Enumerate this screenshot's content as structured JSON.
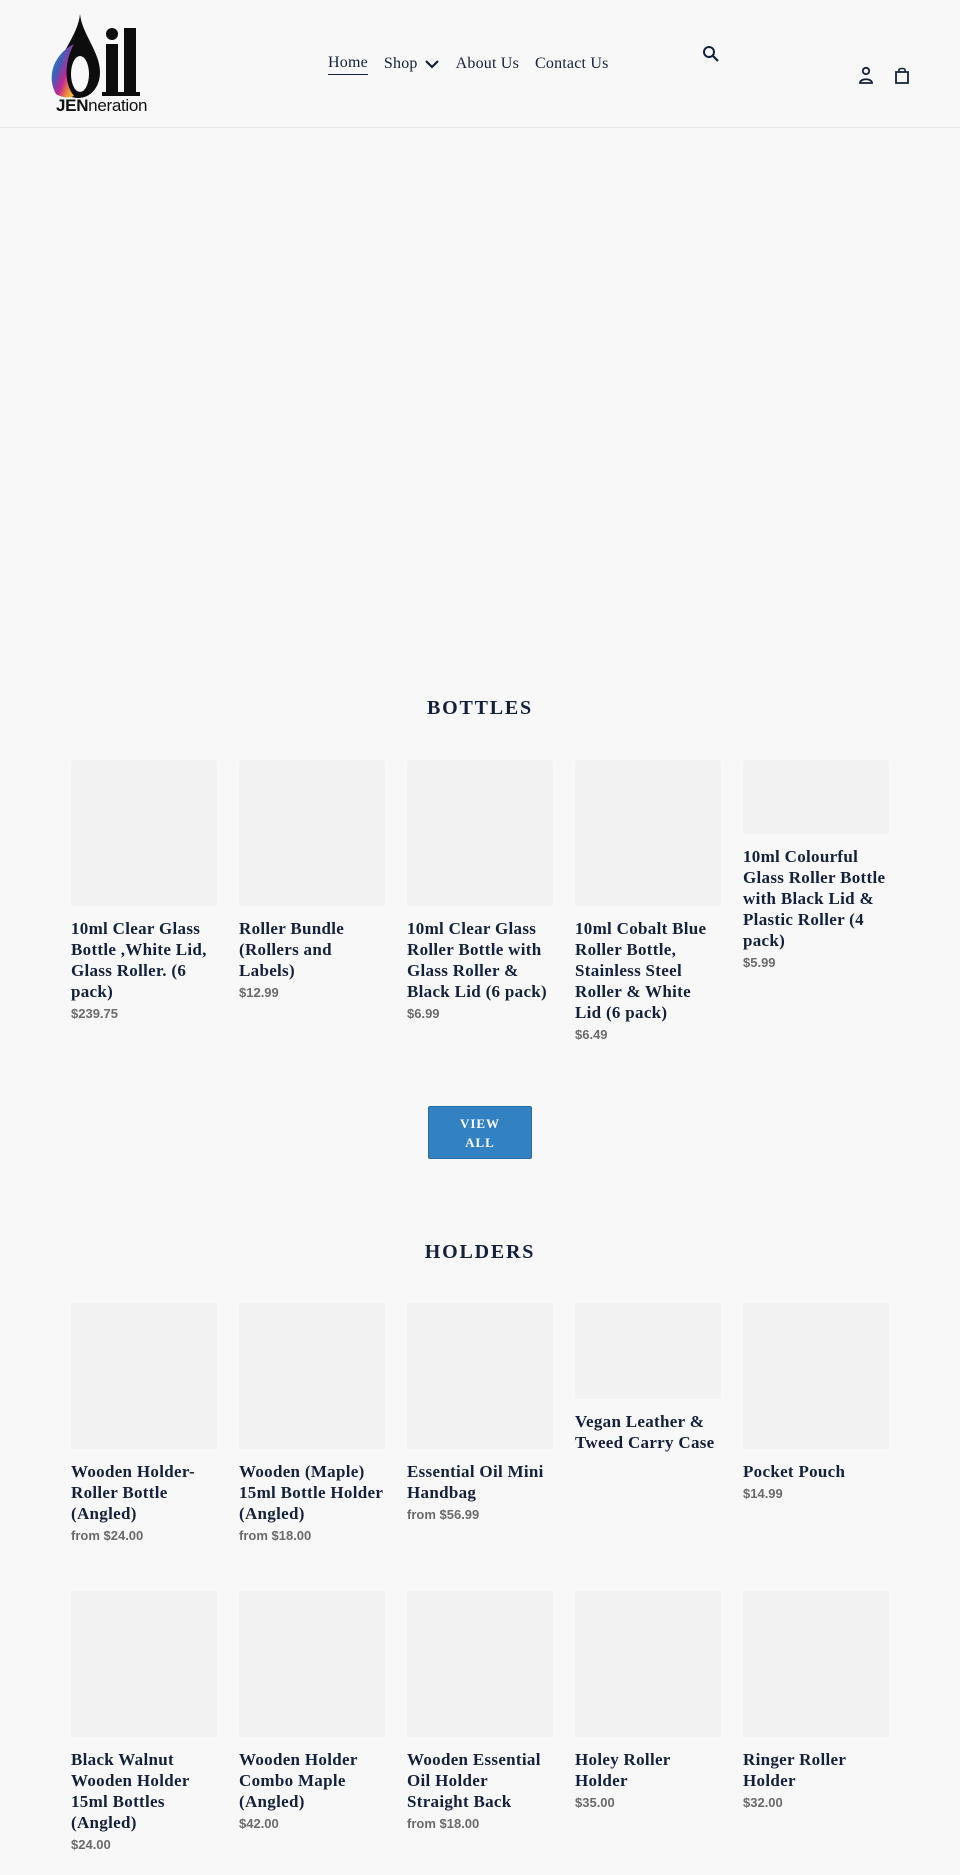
{
  "brand": {
    "logo_main": "Oil",
    "logo_sub_bold": "JEN",
    "logo_sub_rest": "neration"
  },
  "nav": {
    "items": [
      {
        "label": "Home",
        "active": true
      },
      {
        "label": "Shop",
        "has_dropdown": true
      },
      {
        "label": "About Us"
      },
      {
        "label": "Contact Us"
      }
    ]
  },
  "header_icons": {
    "search": "search-icon",
    "account": "account-icon",
    "cart": "cart-icon"
  },
  "colors": {
    "text": "#14213d",
    "price": "#6b6b6b",
    "button": "#3282c3",
    "placeholder": "#f2f2f2",
    "background": "#f8f8f8"
  },
  "sections": {
    "bottles": {
      "title": "BOTTLES",
      "view_all_line1": "VIEW",
      "view_all_line2": "ALL",
      "products": [
        {
          "title": "10ml Clear Glass Bottle ,White Lid, Glass Roller. (6 pack)",
          "price": "$239.75"
        },
        {
          "title": "Roller Bundle (Rollers and Labels)",
          "price": "$12.99"
        },
        {
          "title": "10ml Clear Glass Roller Bottle with Glass Roller & Black Lid (6 pack)",
          "price": "$6.99"
        },
        {
          "title": "10ml Cobalt Blue Roller Bottle, Stainless Steel Roller & White Lid (6 pack)",
          "price": "$6.49"
        },
        {
          "title": "10ml Colourful Glass Roller Bottle with Black Lid & Plastic Roller (4 pack)",
          "price": "$5.99"
        }
      ]
    },
    "holders": {
      "title": "HOLDERS",
      "products": [
        {
          "title": "Wooden Holder- Roller Bottle (Angled)",
          "price": "from $24.00"
        },
        {
          "title": "Wooden (Maple) 15ml Bottle Holder (Angled)",
          "price": "from $18.00"
        },
        {
          "title": "Essential Oil Mini Handbag",
          "price": "from $56.99"
        },
        {
          "title": "Vegan Leather & Tweed Carry Case",
          "price": ""
        },
        {
          "title": "Pocket Pouch",
          "price": "$14.99"
        },
        {
          "title": "Black Walnut Wooden Holder 15ml Bottles (Angled)",
          "price": "$24.00"
        },
        {
          "title": "Wooden Holder Combo Maple (Angled)",
          "price": "$42.00"
        },
        {
          "title": "Wooden Essential Oil Holder Straight Back",
          "price": "from $18.00"
        },
        {
          "title": "Holey Roller Holder",
          "price": "$35.00"
        },
        {
          "title": "Ringer Roller Holder",
          "price": "$32.00"
        }
      ]
    }
  }
}
